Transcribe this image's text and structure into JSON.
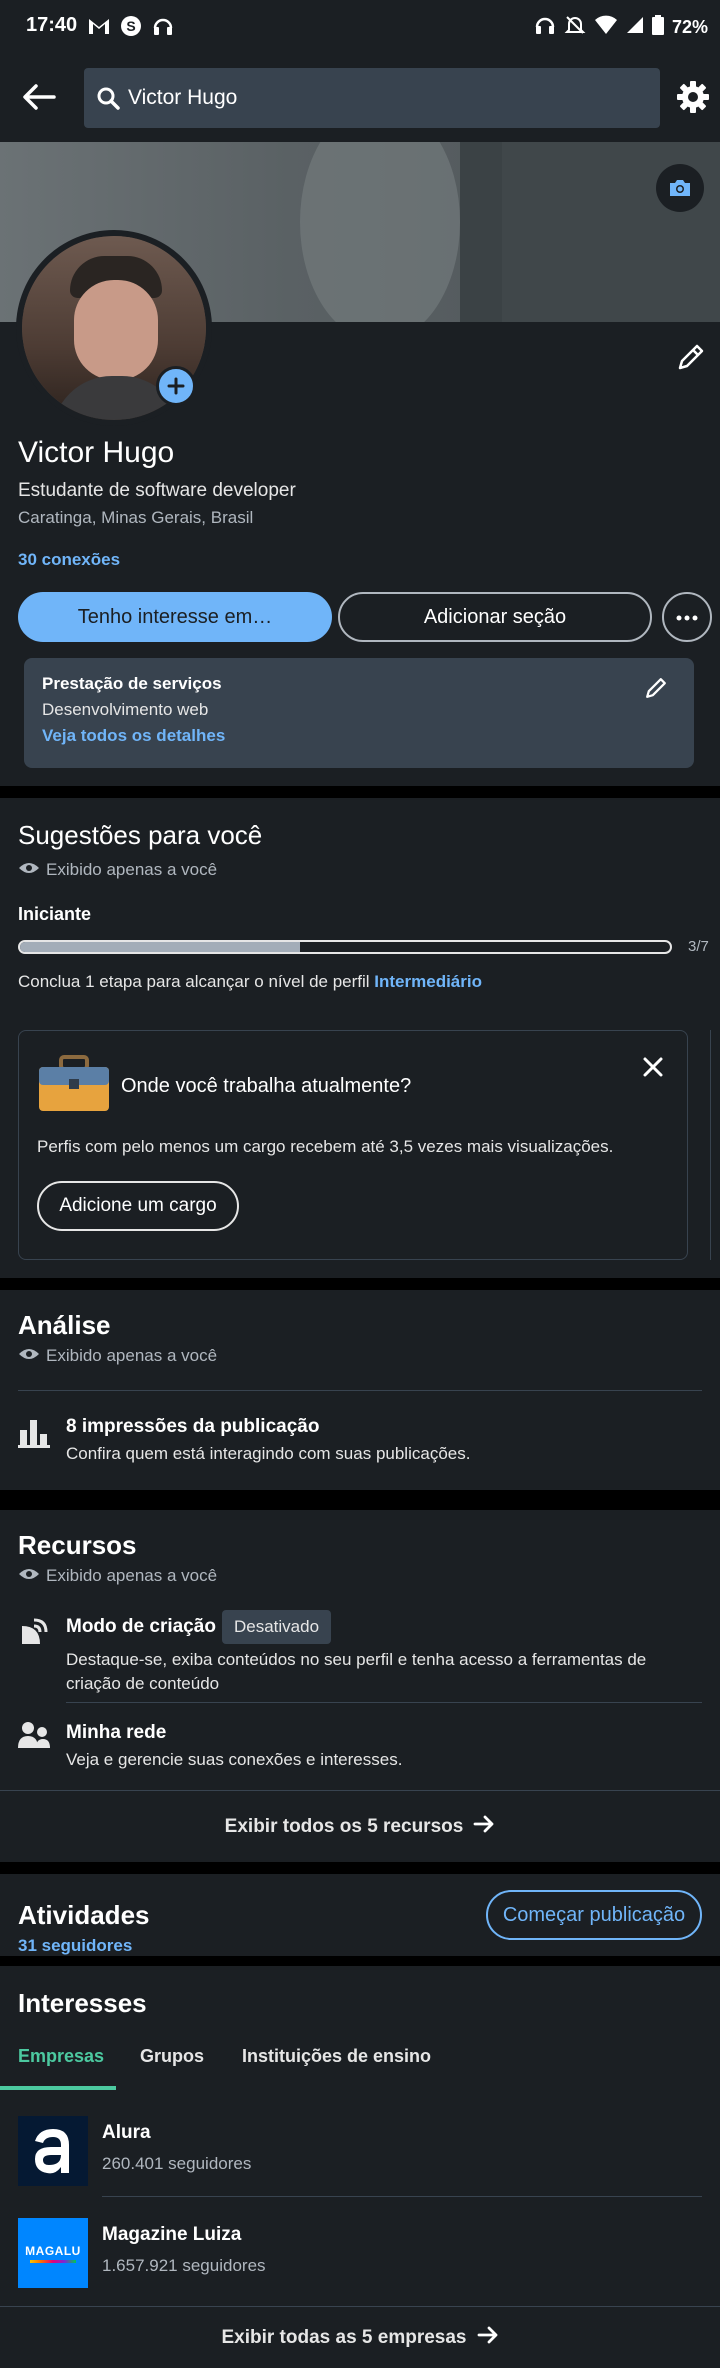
{
  "status_bar": {
    "time": "17:40",
    "battery": "72%",
    "icons_left": [
      "gmail-icon",
      "skype-icon",
      "headphones-icon"
    ],
    "icons_right": [
      "headset-icon",
      "bell-off-icon",
      "wifi-icon",
      "signal-icon",
      "battery-icon"
    ]
  },
  "top_bar": {
    "search_value": "Victor Hugo"
  },
  "profile": {
    "name": "Victor Hugo",
    "headline": "Estudante de software developer",
    "location": "Caratinga, Minas Gerais, Brasil",
    "connections": "30 conexões",
    "btn_interest": "Tenho interesse em…",
    "btn_add_section": "Adicionar seção",
    "services": {
      "title": "Prestação de serviços",
      "desc": "Desenvolvimento web",
      "link": "Veja todos os detalhes"
    }
  },
  "suggestions": {
    "title": "Sugestões para você",
    "visibility": "Exibido apenas a você",
    "level": "Iniciante",
    "progress_label": "3/7",
    "progress_fraction": 0.43,
    "hint_prefix": "Conclua 1 etapa para alcançar o nível de perfil ",
    "hint_link": "Intermediário",
    "card": {
      "title": "Onde você trabalha atualmente?",
      "desc": "Perfis com pelo menos um cargo recebem até 3,5 vezes mais visualizações.",
      "button": "Adicione um cargo"
    }
  },
  "analytics": {
    "title": "Análise",
    "visibility": "Exibido apenas a você",
    "item_title": "8 impressões da publicação",
    "item_desc": "Confira quem está interagindo com suas publicações."
  },
  "resources": {
    "title": "Recursos",
    "visibility": "Exibido apenas a você",
    "creator_title": "Modo de criação",
    "creator_badge": "Desativado",
    "creator_desc_1": "Destaque-se, exiba conteúdos no seu perfil e tenha acesso a ferramentas de",
    "creator_desc_2": "criação de conteúdo",
    "network_title": "Minha rede",
    "network_desc": "Veja e gerencie suas conexões e interesses.",
    "show_all": "Exibir todos os 5 recursos"
  },
  "activity": {
    "title": "Atividades",
    "followers": "31 seguidores",
    "button": "Começar publicação"
  },
  "interests": {
    "title": "Interesses",
    "tabs": [
      "Empresas",
      "Grupos",
      "Instituições de ensino"
    ],
    "companies": [
      {
        "name": "Alura",
        "followers": "260.401 seguidores",
        "logo": "a"
      },
      {
        "name": "Magazine Luiza",
        "followers": "1.657.921 seguidores",
        "logo": "magalu"
      }
    ],
    "show_all": "Exibir todas as 5 empresas"
  },
  "colors": {
    "background": "#1b1f23",
    "accent": "#70b5f9",
    "tab_active": "#4cc9a0"
  }
}
